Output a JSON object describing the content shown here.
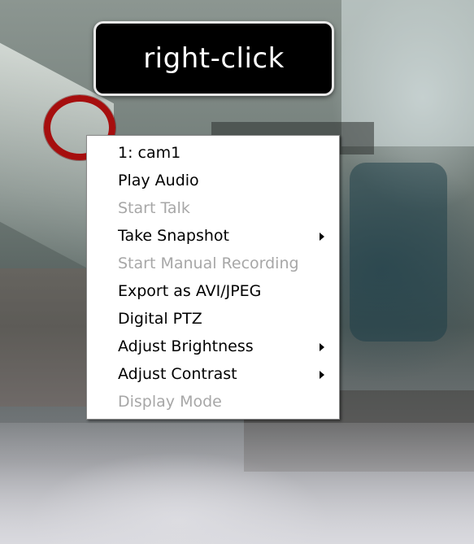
{
  "callout": {
    "label": "right-click"
  },
  "context_menu": {
    "items": [
      {
        "label": "1: cam1",
        "enabled": true,
        "submenu": false
      },
      {
        "label": "Play Audio",
        "enabled": true,
        "submenu": false
      },
      {
        "label": "Start Talk",
        "enabled": false,
        "submenu": false
      },
      {
        "label": "Take Snapshot",
        "enabled": true,
        "submenu": true
      },
      {
        "label": "Start Manual Recording",
        "enabled": false,
        "submenu": false
      },
      {
        "label": "Export as AVI/JPEG",
        "enabled": true,
        "submenu": false
      },
      {
        "label": "Digital PTZ",
        "enabled": true,
        "submenu": false
      },
      {
        "label": "Adjust Brightness",
        "enabled": true,
        "submenu": true
      },
      {
        "label": "Adjust Contrast",
        "enabled": true,
        "submenu": true
      },
      {
        "label": "Display Mode",
        "enabled": false,
        "submenu": false
      }
    ]
  },
  "colors": {
    "highlight_ring": "#a60e0e",
    "callout_bg": "#000000",
    "disabled_text": "#a7a7a7"
  }
}
